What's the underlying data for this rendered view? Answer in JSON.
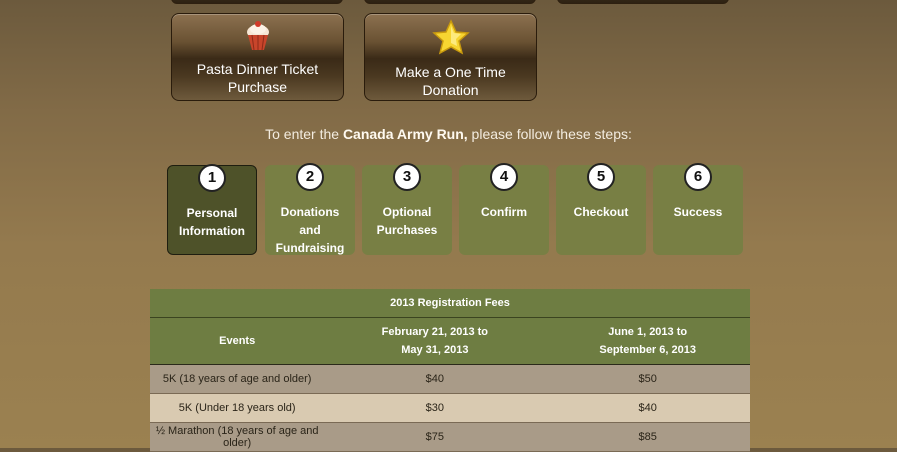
{
  "top_tiles": [
    "",
    "",
    ""
  ],
  "tiles": [
    {
      "label": "Pasta Dinner Ticket Purchase",
      "icon": "cupcake-icon"
    },
    {
      "label": "Make a One Time Donation",
      "icon": "star-icon"
    }
  ],
  "intro": {
    "before": "To enter the ",
    "event": "Canada Army Run,",
    "after": " please follow these steps:"
  },
  "steps": [
    {
      "number": "1",
      "label": "Personal Information",
      "active": true
    },
    {
      "number": "2",
      "label": "Donations and Fundraising",
      "active": false
    },
    {
      "number": "3",
      "label": "Optional Purchases",
      "active": false
    },
    {
      "number": "4",
      "label": "Confirm",
      "active": false
    },
    {
      "number": "5",
      "label": "Checkout",
      "active": false
    },
    {
      "number": "6",
      "label": "Success",
      "active": false
    }
  ],
  "fees": {
    "caption": "2013 Registration Fees",
    "columns": [
      "Events",
      "February 21, 2013 to May 31, 2013",
      "June 1, 2013 to September 6, 2013"
    ],
    "rows": [
      [
        "5K (18 years of age and older)",
        "$40",
        "$50"
      ],
      [
        "5K (Under 18 years old)",
        "$30",
        "$40"
      ],
      [
        "½ Marathon (18 years of age and older)",
        "$75",
        "$85"
      ]
    ]
  },
  "colors": {
    "step_bg": "#787f44",
    "step_active_bg": "#4e5229",
    "table_header": "#6e7d42",
    "row_odd": "#a99b88",
    "row_even": "#d9cab1"
  }
}
